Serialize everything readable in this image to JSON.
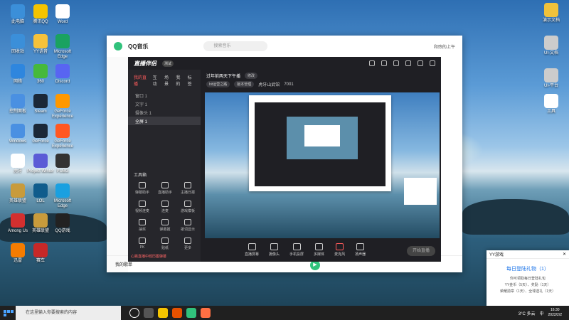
{
  "desktop": {
    "icons_left": [
      {
        "label": "此电脑",
        "color": "#3b8fd9"
      },
      {
        "label": "腾讯QQ",
        "color": "#f5c400"
      },
      {
        "label": "Word",
        "color": "#ffffff"
      },
      {
        "label": "回收站",
        "color": "#3b8fd9"
      },
      {
        "label": "YY语音",
        "color": "#f6c23b"
      },
      {
        "label": "Microsoft Edge",
        "color": "#1aa260"
      },
      {
        "label": "网络",
        "color": "#2e86de"
      },
      {
        "label": "360",
        "color": "#46b93b"
      },
      {
        "label": "Discord",
        "color": "#5865f2"
      },
      {
        "label": "控制面板",
        "color": "#4a90e2"
      },
      {
        "label": "Steam",
        "color": "#1b2838"
      },
      {
        "label": "GeForce Experience",
        "color": "#ff9800"
      },
      {
        "label": "Windows",
        "color": "#4a90e2"
      },
      {
        "label": "GeForce",
        "color": "#1b2838"
      },
      {
        "label": "GeForce Experience",
        "color": "#ff5722"
      },
      {
        "label": "虎牙",
        "color": "#ffffff"
      },
      {
        "label": "Project Winter",
        "color": "#5b5bd6"
      },
      {
        "label": "PUBG",
        "color": "#333333"
      },
      {
        "label": "英雄联盟",
        "color": "#c89b3c"
      },
      {
        "label": "LOL",
        "color": "#0f5c8c"
      },
      {
        "label": "Microsoft Edge",
        "color": "#1aa0e0"
      },
      {
        "label": "Among Us",
        "color": "#d32f2f"
      },
      {
        "label": "英雄联盟",
        "color": "#c89b3c"
      },
      {
        "label": "QQ游戏",
        "color": "#222222"
      },
      {
        "label": "迅雷",
        "color": "#f57c00"
      },
      {
        "label": "赛车",
        "color": "#c62828"
      }
    ],
    "icons_right": [
      {
        "label": "演示文档",
        "color": "#f0c23b"
      },
      {
        "label": "UI-文档",
        "color": "#cccccc"
      },
      {
        "label": "UI-平台",
        "color": "#cccccc"
      },
      {
        "label": "工具",
        "color": "#ffffff"
      }
    ]
  },
  "qq_music": {
    "title": "QQ音乐",
    "search_placeholder": "搜索音乐",
    "user": "和煦的上午",
    "bottom_left": "我的歌单"
  },
  "live": {
    "brand": "直播伴侣",
    "badge": "测试",
    "tabs": [
      "我的直播",
      "互动",
      "场景",
      "我的",
      "标签"
    ],
    "scenes": [
      "窗口 1",
      "文字 1",
      "摄像头 1",
      "全屏 1"
    ],
    "tools_title": "工具箱",
    "tools": [
      "弹幕助手",
      "直播助手",
      "主播日报",
      "视频连麦",
      "连麦",
      "游戏模板",
      "抽奖",
      "弹幕姬",
      "歌词显示",
      "PK",
      "贴纸",
      "更多"
    ],
    "footer": "心跳直播中经历图弹幕",
    "stream_title": "过年前两天下午播",
    "stream_tag": "修改",
    "info_pills": [
      "bit运营之路",
      "版本管理",
      "虎牙山武馆",
      "7001"
    ],
    "controls": [
      "直播屏幕",
      "摄像头",
      "手机投屏",
      "多媒体",
      "麦克风",
      "扬声器"
    ],
    "start_button": "开始直播"
  },
  "yy_popup": {
    "header": "YY游戏",
    "title": "每日登陆礼物（1）",
    "line1": "你可领取每日登陆礼包",
    "line2": "YY金币（5天）、奖励（1天）",
    "line3": "荣耀勋章（1天）、全球送礼（1天）"
  },
  "taskbar": {
    "search_placeholder": "在这里输入你要搜索的内容",
    "weather": "3°C 多云",
    "time": "16:30",
    "date": "2022/2/2",
    "ime": "中"
  }
}
